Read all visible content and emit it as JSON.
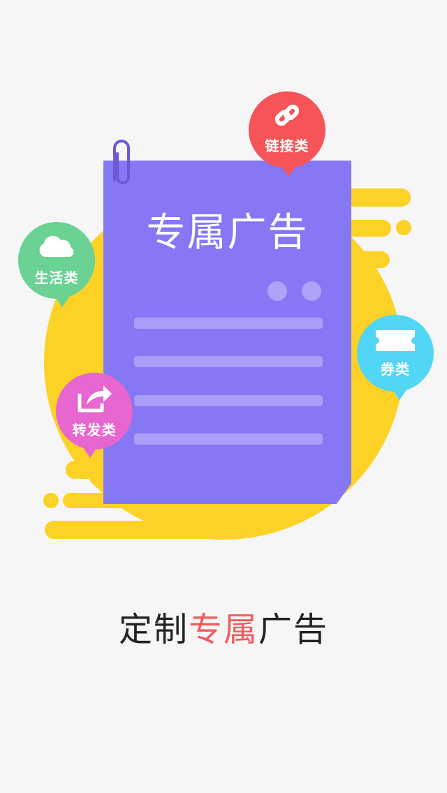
{
  "illustration": {
    "paper_title": "专属广告",
    "bubbles": {
      "link": {
        "label": "链接类",
        "icon": "link-icon",
        "color": "#f65459"
      },
      "life": {
        "label": "生活类",
        "icon": "cloud-icon",
        "color": "#6ad292"
      },
      "coupon": {
        "label": "券类",
        "icon": "ticket-icon",
        "color": "#52d6f5"
      },
      "share": {
        "label": "转发类",
        "icon": "share-icon",
        "color": "#e766cf"
      }
    },
    "colors": {
      "background": "#f6f6f6",
      "yellow": "#fcd226",
      "paper": "#8677f5"
    }
  },
  "caption": {
    "prefix": "定制",
    "highlight": "专属",
    "suffix": "广告",
    "highlight_color": "#f45b5d"
  }
}
